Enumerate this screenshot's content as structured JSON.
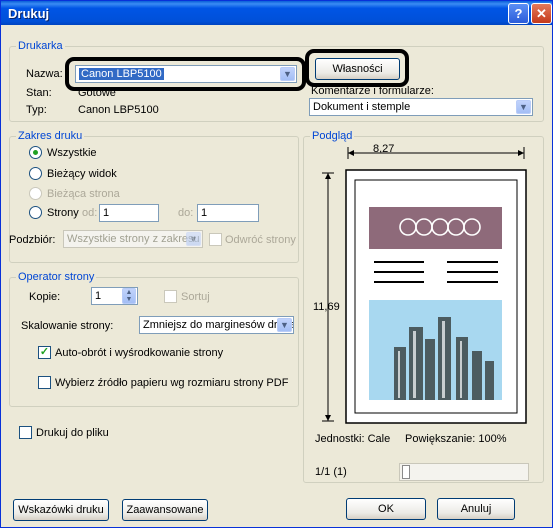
{
  "window": {
    "title": "Drukuj"
  },
  "printer": {
    "group_label": "Drukarka",
    "name_label": "Nazwa:",
    "name_value": "Canon LBP5100",
    "status_label": "Stan:",
    "status_value": "Gotowe",
    "type_label": "Typ:",
    "type_value": "Canon LBP5100",
    "properties_button": "Własności",
    "comments_label": "Komentarze i formularze:",
    "comments_value": "Dokument i stemple"
  },
  "range": {
    "group_label": "Zakres druku",
    "all_label": "Wszystkie",
    "current_view_label": "Bieżący widok",
    "current_page_label": "Bieżąca strona",
    "pages_label": "Strony",
    "from_label": "od:",
    "from_value": "1",
    "to_label": "do:",
    "to_value": "1",
    "subset_label": "Podzbiór:",
    "subset_value": "Wszystkie strony z zakresu",
    "reverse_label": "Odwróć strony"
  },
  "handling": {
    "group_label": "Operator strony",
    "copies_label": "Kopie:",
    "copies_value": "1",
    "collate_label": "Sortuj",
    "scaling_label": "Skalowanie strony:",
    "scaling_value": "Zmniejsz do marginesów drukarki",
    "autorotate_label": "Auto-obrót i wyśrodkowanie strony",
    "autorotate_checked": true,
    "pdf_source_label": "Wybierz źródło papieru wg rozmiaru strony PDF",
    "pdf_source_checked": false
  },
  "print_to_file_label": "Drukuj do pliku",
  "preview": {
    "group_label": "Podgląd",
    "width": "8,27",
    "height": "11,69",
    "units_label": "Jednostki: Cale",
    "zoom_label": "Powiększanie: 100%",
    "page_counter": "1/1 (1)"
  },
  "footer": {
    "tips_button": "Wskazówki druku",
    "advanced_button": "Zaawansowane",
    "ok_button": "OK",
    "cancel_button": "Anuluj"
  },
  "colors": {
    "highlight": "#316AC5",
    "title_bar": "#0055E5",
    "preview_band": "#8E6A7A",
    "preview_sky": "#A8D8F0"
  }
}
